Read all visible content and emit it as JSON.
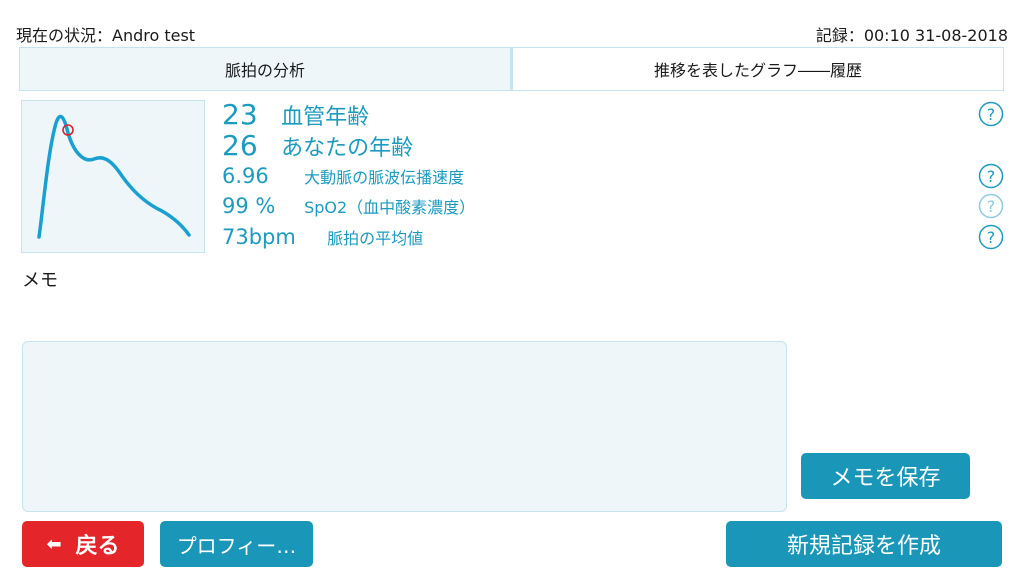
{
  "status": {
    "current_prefix": "現在の状況：Andro test",
    "record": "記録：00:10 31-08-2018"
  },
  "tabs": [
    {
      "label": "脈拍の分析",
      "active": true
    },
    {
      "label": "推移を表したグラフ――履歴",
      "active": false
    }
  ],
  "metrics": {
    "vascular_age": {
      "value": "23",
      "label": "血管年齢"
    },
    "your_age": {
      "value": "26",
      "label": "あなたの年齢"
    },
    "pwv": {
      "value": "6.96",
      "label": "大動脈の脈波伝播速度"
    },
    "spo2": {
      "value": "99 %",
      "label": "SpO2（血中酸素濃度）"
    },
    "pulse": {
      "value": "73bpm",
      "label": "脈拍の平均値"
    }
  },
  "memo": {
    "label": "メモ",
    "value": ""
  },
  "buttons": {
    "save_memo": "メモを保存",
    "back": "戻る",
    "profile": "プロフィー…",
    "new_record": "新規記録を作成"
  },
  "icons": {
    "help": "question-mark-circle-icon",
    "back": "left-arrow-icon"
  },
  "colors": {
    "accent": "#1a97b8",
    "metric_text": "#1d9bbf",
    "back_button": "#e4252a",
    "panel_bg": "#eef6f9",
    "wave": "#1aa0d0",
    "marker": "#d9232a"
  }
}
